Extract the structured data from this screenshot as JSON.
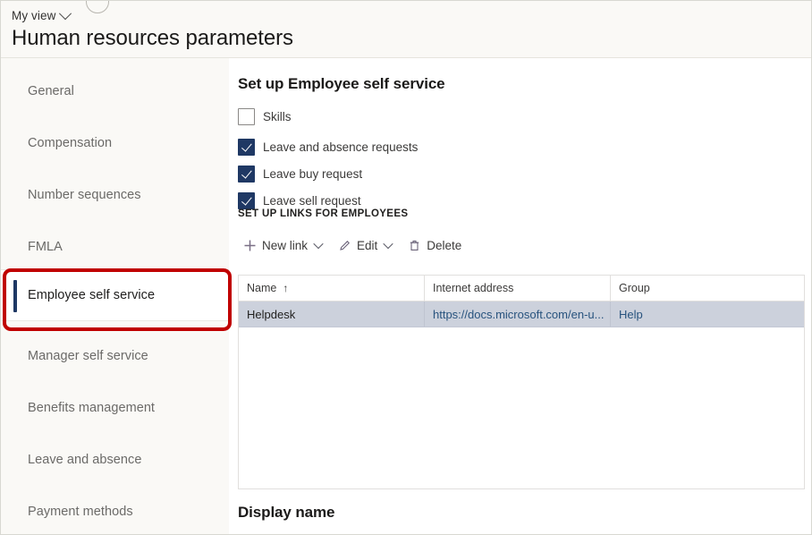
{
  "header": {
    "view_label": "My view",
    "view_chevron_icon": "chevron-down-icon",
    "page_title": "Human resources parameters"
  },
  "sidebar": {
    "items": [
      {
        "label": "General",
        "selected": false
      },
      {
        "label": "Compensation",
        "selected": false
      },
      {
        "label": "Number sequences",
        "selected": false
      },
      {
        "label": "FMLA",
        "selected": false
      },
      {
        "label": "Employee self service",
        "selected": true
      },
      {
        "label": "Manager self service",
        "selected": false
      },
      {
        "label": "Benefits management",
        "selected": false
      },
      {
        "label": "Leave and absence",
        "selected": false
      },
      {
        "label": "Payment methods",
        "selected": false
      }
    ]
  },
  "annotation": {
    "color": "#c00000",
    "target": "Employee self service"
  },
  "main": {
    "section_title": "Set up Employee self service",
    "checkboxes": [
      {
        "label": "Skills",
        "checked": false
      },
      {
        "label": "Leave and absence requests",
        "checked": true
      },
      {
        "label": "Leave buy request",
        "checked": true
      },
      {
        "label": "Leave sell request",
        "checked": true
      }
    ],
    "group_header": "SET UP LINKS FOR EMPLOYEES",
    "toolbar": [
      {
        "label": "New link",
        "icon": "plus-icon",
        "has_chevron": true
      },
      {
        "label": "Edit",
        "icon": "pencil-icon",
        "has_chevron": true
      },
      {
        "label": "Delete",
        "icon": "trash-icon",
        "has_chevron": false
      }
    ],
    "grid": {
      "columns": [
        {
          "label": "Name",
          "sort_indicator": "↑"
        },
        {
          "label": "Internet address",
          "sort_indicator": ""
        },
        {
          "label": "Group",
          "sort_indicator": ""
        }
      ],
      "rows": [
        {
          "name": "Helpdesk",
          "internet_address": "https://docs.microsoft.com/en-u...",
          "group": "Help",
          "selected": true
        }
      ]
    },
    "display_name_label": "Display name"
  },
  "colors": {
    "accent": "#1f3864",
    "annotation": "#c00000",
    "selected_row": "#ccd1dc",
    "link": "#28537e",
    "sidebar_bg": "#faf9f6"
  }
}
